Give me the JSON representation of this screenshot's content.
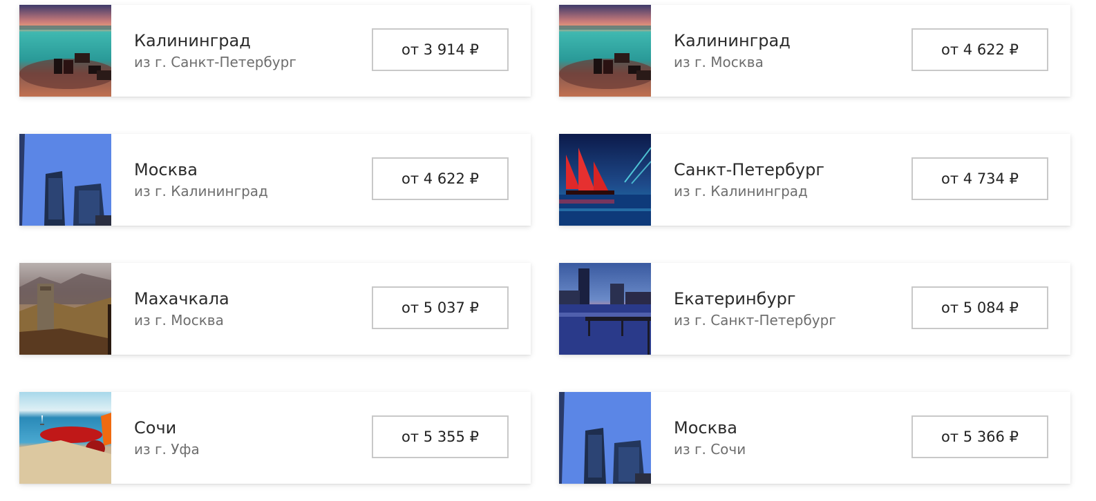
{
  "cards": [
    {
      "city": "Калининград",
      "from": "из г. Санкт-Петербург",
      "price": "от 3 914 ₽",
      "image": "beach-rocks-sunset"
    },
    {
      "city": "Калининград",
      "from": "из г. Москва",
      "price": "от 4 622 ₽",
      "image": "beach-rocks-sunset"
    },
    {
      "city": "Москва",
      "from": "из г. Калининград",
      "price": "от 4 622 ₽",
      "image": "skyscrapers-blue"
    },
    {
      "city": "Санкт-Петербург",
      "from": "из г. Калининград",
      "price": "от 4 734 ₽",
      "image": "scarlet-sails-ship"
    },
    {
      "city": "Махачкала",
      "from": "из г. Москва",
      "price": "от 5 037 ₽",
      "image": "mountain-tower"
    },
    {
      "city": "Екатеринбург",
      "from": "из г. Санкт-Петербург",
      "price": "от 5 084 ₽",
      "image": "city-pier-night"
    },
    {
      "city": "Сочи",
      "from": "из г. Уфа",
      "price": "от 5 355 ₽",
      "image": "beach-sand-sea"
    },
    {
      "city": "Москва",
      "from": "из г. Сочи",
      "price": "от 5 366 ₽",
      "image": "skyscrapers-blue"
    }
  ]
}
